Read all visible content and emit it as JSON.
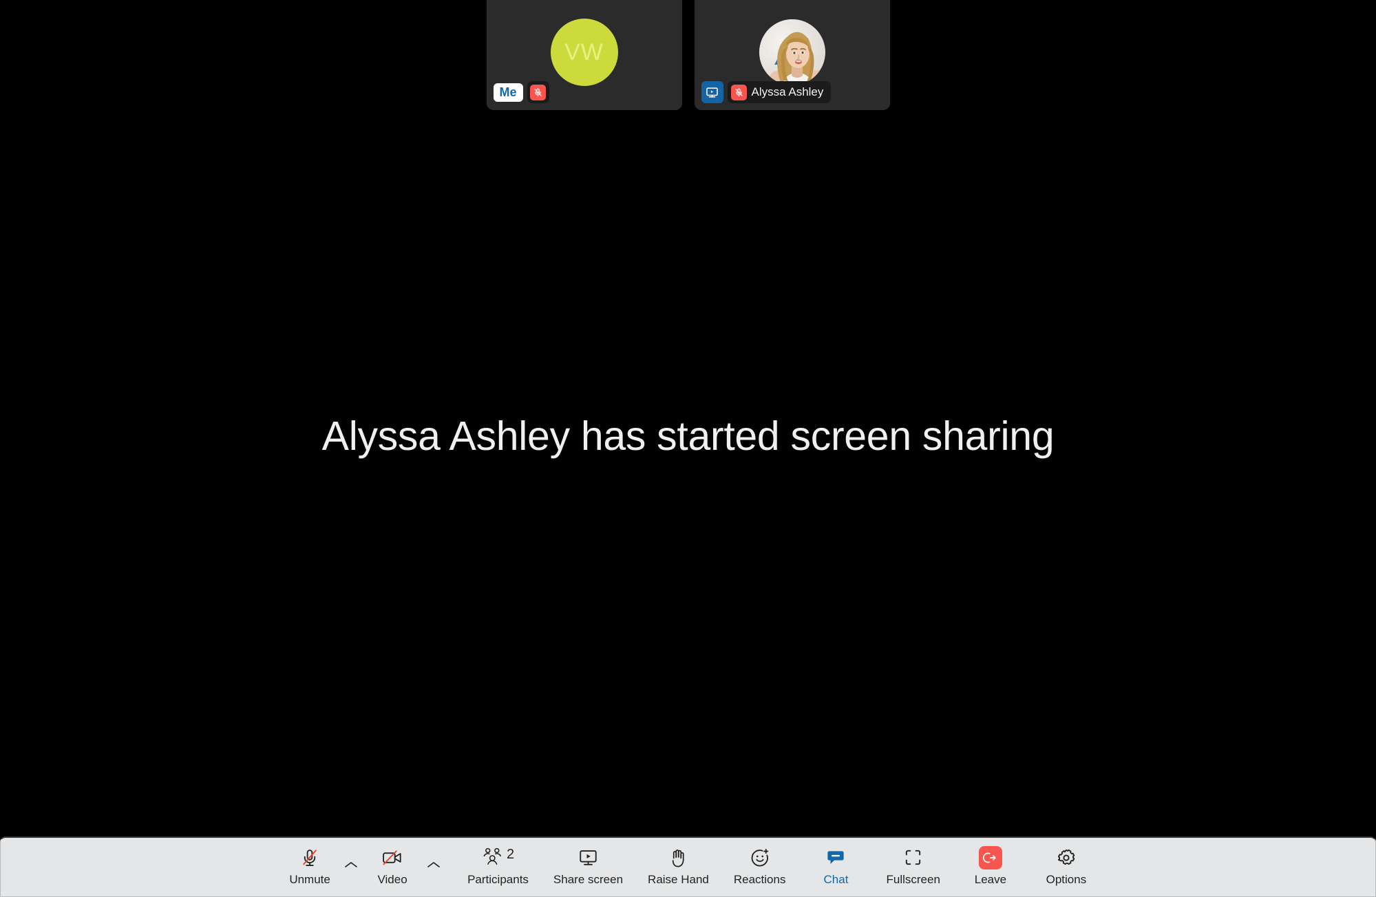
{
  "meeting": {
    "center_message": "Alyssa Ashley has started screen sharing",
    "background_color": "#000000"
  },
  "filmstrip": {
    "tiles": [
      {
        "type": "avatar",
        "initials": "VW",
        "avatar_color": "#cdda3c",
        "initials_color": "#e8f07f",
        "badge_label": "Me",
        "badge_label_color": "#1267a8",
        "muted": true,
        "mic_icon": "mic-muted-icon",
        "sharing": false,
        "name": ""
      },
      {
        "type": "photo",
        "initials": "",
        "avatar_color": "#cfcfcf",
        "initials_color": "#ffffff",
        "badge_label": "",
        "badge_label_color": "",
        "muted": true,
        "mic_icon": "mic-muted-icon",
        "sharing": true,
        "share_icon": "screen-share-icon",
        "name": "Alyssa Ashley"
      }
    ]
  },
  "toolbar": {
    "background_color": "#e4e6e7",
    "active_color": "#1267a8",
    "leave_color": "#f9554f",
    "items": [
      {
        "id": "unmute",
        "label": "Unmute",
        "icon": "mic-muted-icon",
        "active": false,
        "caret": true,
        "count": ""
      },
      {
        "id": "video",
        "label": "Video",
        "icon": "video-off-icon",
        "active": false,
        "caret": true,
        "count": ""
      },
      {
        "id": "participants",
        "label": "Participants",
        "icon": "participants-icon",
        "active": false,
        "caret": false,
        "count": "2"
      },
      {
        "id": "share-screen",
        "label": "Share screen",
        "icon": "screen-share-icon",
        "active": false,
        "caret": false,
        "count": ""
      },
      {
        "id": "raise-hand",
        "label": "Raise Hand",
        "icon": "raised-hand-icon",
        "active": false,
        "caret": false,
        "count": ""
      },
      {
        "id": "reactions",
        "label": "Reactions",
        "icon": "smiley-plus-icon",
        "active": false,
        "caret": false,
        "count": ""
      },
      {
        "id": "chat",
        "label": "Chat",
        "icon": "chat-bubble-icon",
        "active": true,
        "caret": false,
        "count": ""
      },
      {
        "id": "fullscreen",
        "label": "Fullscreen",
        "icon": "fullscreen-icon",
        "active": false,
        "caret": false,
        "count": ""
      },
      {
        "id": "leave",
        "label": "Leave",
        "icon": "leave-exit-icon",
        "active": false,
        "caret": false,
        "count": ""
      },
      {
        "id": "options",
        "label": "Options",
        "icon": "gear-icon",
        "active": false,
        "caret": false,
        "count": ""
      }
    ]
  }
}
